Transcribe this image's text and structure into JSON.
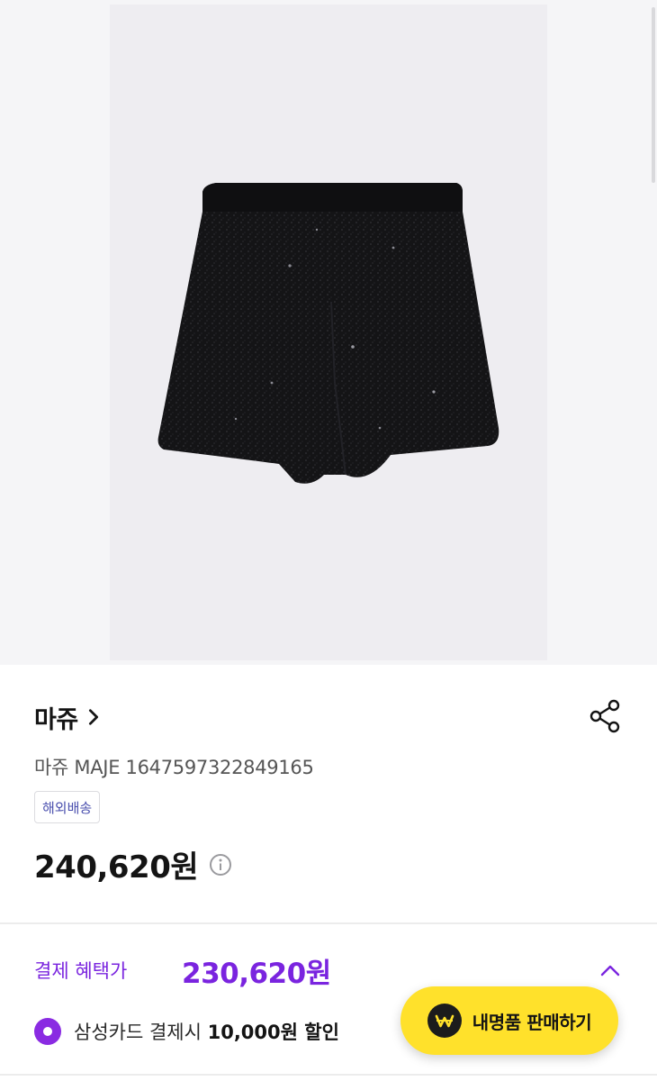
{
  "product": {
    "brand": "마쥬",
    "name": "마쥬 MAJE 1647597322849165",
    "badge": "해외배송",
    "price": "240,620원"
  },
  "benefit": {
    "label": "결제 혜택가",
    "price": "230,620원",
    "card_prefix": "삼성카드 결제시 ",
    "card_discount": "10,000원 할인"
  },
  "cta": {
    "label": "내명품 판매하기"
  },
  "colors": {
    "accent": "#7a24df",
    "cta": "#ffe12b"
  },
  "icons": [
    "chevron-right-icon",
    "share-icon",
    "info-icon",
    "chevron-up-icon",
    "won-icon"
  ]
}
